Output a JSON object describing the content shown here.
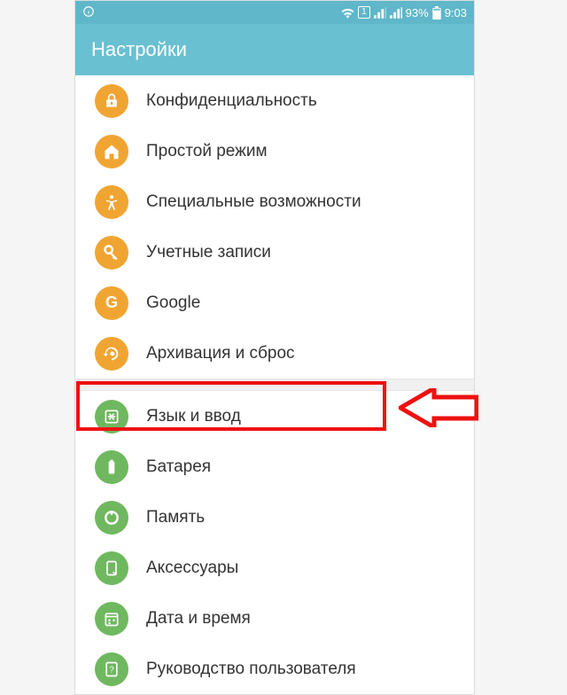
{
  "status": {
    "battery_pct": "93%",
    "time": "9:03",
    "sim": "1"
  },
  "header": {
    "title": "Настройки"
  },
  "groups": [
    {
      "items": [
        {
          "id": "privacy",
          "label": "Конфиденциальность",
          "color": "#f0a532",
          "icon": "lock"
        },
        {
          "id": "easy-mode",
          "label": "Простой режим",
          "color": "#f0a532",
          "icon": "home"
        },
        {
          "id": "accessibility",
          "label": "Специальные возможности",
          "color": "#f0a532",
          "icon": "accessibility"
        },
        {
          "id": "accounts",
          "label": "Учетные записи",
          "color": "#f0a532",
          "icon": "key"
        },
        {
          "id": "google",
          "label": "Google",
          "color": "#f0a532",
          "icon": "google"
        },
        {
          "id": "backup-reset",
          "label": "Архивация и сброс",
          "color": "#f0a532",
          "icon": "backup"
        }
      ]
    },
    {
      "items": [
        {
          "id": "language-input",
          "label": "Язык и ввод",
          "color": "#6fb85f",
          "icon": "language",
          "highlighted": true
        },
        {
          "id": "battery",
          "label": "Батарея",
          "color": "#6fb85f",
          "icon": "battery"
        },
        {
          "id": "memory",
          "label": "Память",
          "color": "#6fb85f",
          "icon": "memory"
        },
        {
          "id": "accessories",
          "label": "Аксессуары",
          "color": "#6fb85f",
          "icon": "accessories"
        },
        {
          "id": "date-time",
          "label": "Дата и время",
          "color": "#6fb85f",
          "icon": "calendar"
        },
        {
          "id": "user-guide",
          "label": "Руководство пользователя",
          "color": "#6fb85f",
          "icon": "guide"
        }
      ]
    }
  ],
  "annotation": {
    "highlight_target": "language-input",
    "arrow_color": "#e11"
  }
}
